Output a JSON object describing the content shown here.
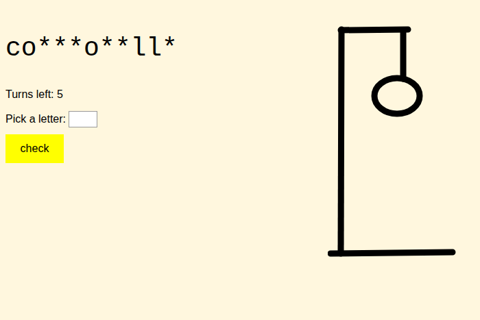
{
  "word": "co***o**ll*",
  "turns": "Turns left: 5",
  "prompt": "Pick a letter:",
  "input": {
    "value": ""
  },
  "button": "check",
  "hangman": {
    "parts": [
      {
        "kind": "head",
        "drawn": true
      },
      {
        "kind": "body",
        "drawn": false
      },
      {
        "kind": "left-arm",
        "drawn": false
      },
      {
        "kind": "right-arm",
        "drawn": false
      },
      {
        "kind": "left-leg",
        "drawn": false
      },
      {
        "kind": "right-leg",
        "drawn": false
      }
    ]
  }
}
